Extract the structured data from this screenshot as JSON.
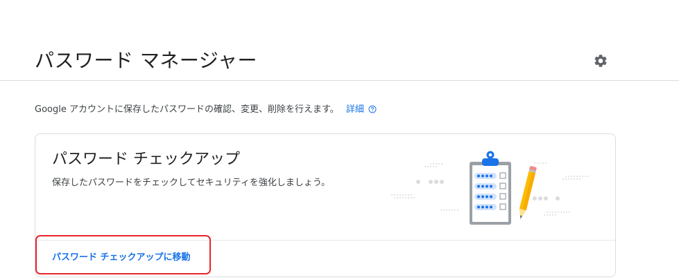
{
  "header": {
    "title": "パスワード マネージャー",
    "settings_icon": "gear-icon"
  },
  "intro": {
    "description": "Google アカウントに保存したパスワードの確認、変更、削除を行えます。",
    "learn_more": "詳細",
    "help_icon": "help-circle-icon"
  },
  "checkup_card": {
    "title": "パスワード チェックアップ",
    "description": "保存したパスワードをチェックしてセキュリティを強化しましょう。",
    "illustration": "clipboard-checklist-illustration",
    "action_label": "パスワード チェックアップに移動"
  },
  "colors": {
    "link": "#1a73e8",
    "highlight": "#e8242a"
  }
}
